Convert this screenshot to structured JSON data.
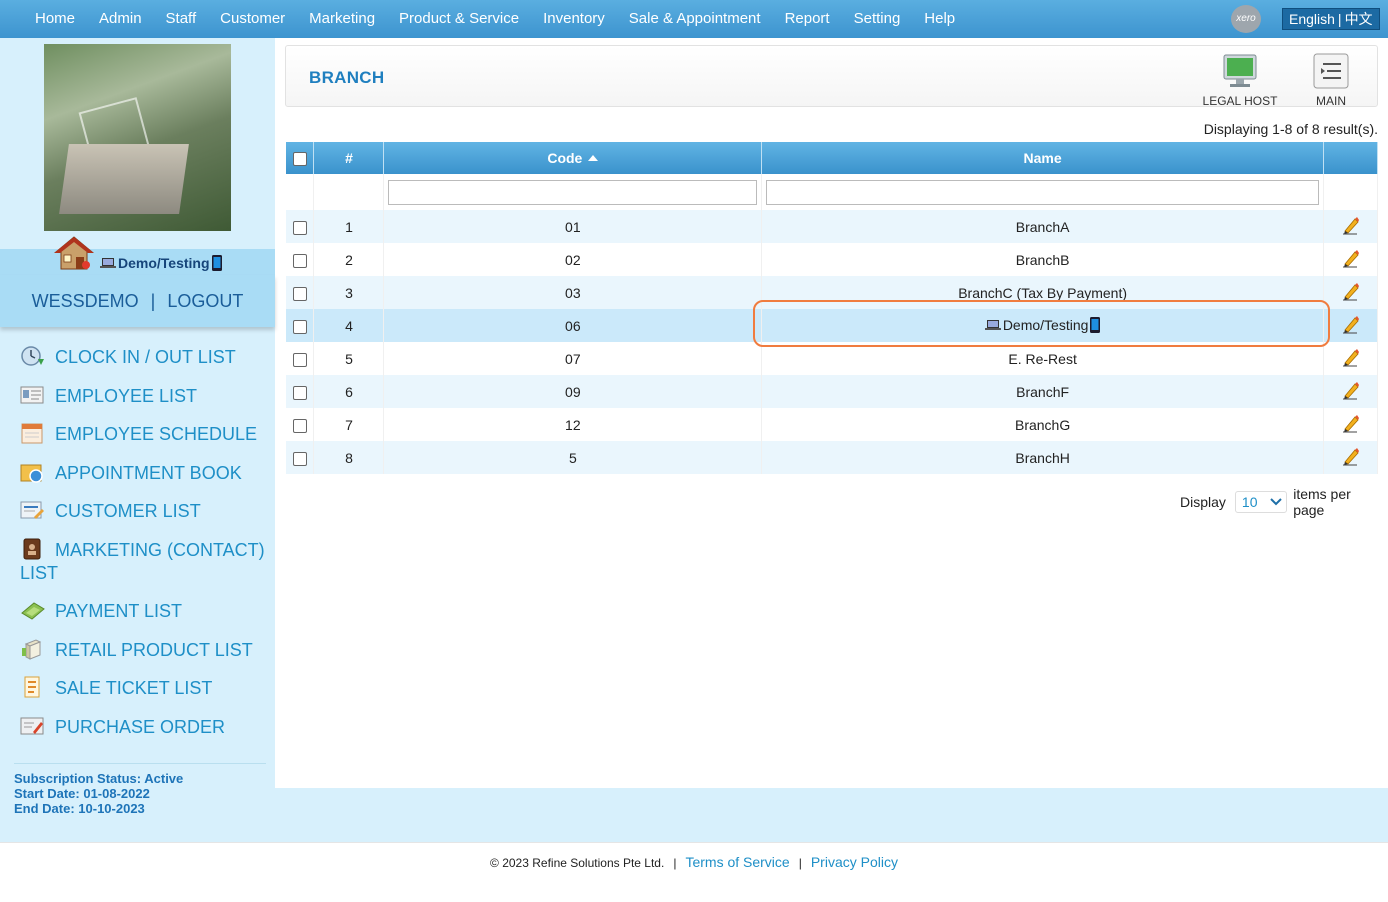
{
  "nav": {
    "items": [
      "Home",
      "Admin",
      "Staff",
      "Customer",
      "Marketing",
      "Product & Service",
      "Inventory",
      "Sale & Appointment",
      "Report",
      "Setting",
      "Help"
    ],
    "xero_label": "xero",
    "lang_en": "English",
    "lang_sep": "|",
    "lang_zh": "中文"
  },
  "sidebar": {
    "branch_name": "Demo/Testing",
    "username": "WESSDEMO",
    "separator": "|",
    "logout": "LOGOUT",
    "menu": [
      {
        "label": "CLOCK IN / OUT LIST",
        "icon": "clock-icon"
      },
      {
        "label": "EMPLOYEE LIST",
        "icon": "employee-card-icon"
      },
      {
        "label": "EMPLOYEE SCHEDULE",
        "icon": "calendar-icon"
      },
      {
        "label": "APPOINTMENT BOOK",
        "icon": "appointment-book-icon"
      },
      {
        "label": "CUSTOMER LIST",
        "icon": "customer-list-icon"
      },
      {
        "label": "MARKETING (CONTACT) LIST",
        "icon": "contact-book-icon"
      },
      {
        "label": "PAYMENT LIST",
        "icon": "payment-icon"
      },
      {
        "label": "RETAIL PRODUCT LIST",
        "icon": "retail-product-icon"
      },
      {
        "label": "SALE TICKET LIST",
        "icon": "sale-ticket-icon"
      },
      {
        "label": "PURCHASE ORDER",
        "icon": "purchase-order-icon"
      }
    ],
    "subscription": {
      "status": "Subscription Status: Active",
      "start": "Start Date: 01-08-2022",
      "end": "End Date: 10-10-2023"
    }
  },
  "page": {
    "title": "BRANCH",
    "legal_host": "LEGAL HOST",
    "main": "MAIN",
    "results": "Displaying 1-8 of 8 result(s)."
  },
  "table": {
    "headers": {
      "num": "#",
      "code": "Code",
      "name": "Name"
    },
    "rows": [
      {
        "num": "1",
        "code": "01",
        "name": "BranchA"
      },
      {
        "num": "2",
        "code": "02",
        "name": "BranchB"
      },
      {
        "num": "3",
        "code": "03",
        "name": "BranchC (Tax By Payment)"
      },
      {
        "num": "4",
        "code": "06",
        "name": "Demo/Testing"
      },
      {
        "num": "5",
        "code": "07",
        "name": "E. Re-Rest"
      },
      {
        "num": "6",
        "code": "09",
        "name": "BranchF"
      },
      {
        "num": "7",
        "code": "12",
        "name": "BranchG"
      },
      {
        "num": "8",
        "code": "5",
        "name": "BranchH"
      }
    ]
  },
  "pager": {
    "display": "Display",
    "per_page": "10",
    "items_per_page": "items per page"
  },
  "footer": {
    "copyright": "© 2023 Refine Solutions Pte Ltd.",
    "sep": "|",
    "terms": "Terms of Service",
    "privacy": "Privacy Policy"
  },
  "colors": {
    "accent": "#1e8fc7",
    "header_blue": "#3a92cc",
    "sidebar_bg": "#d7f0fc",
    "highlight_border": "#f07c3f"
  }
}
